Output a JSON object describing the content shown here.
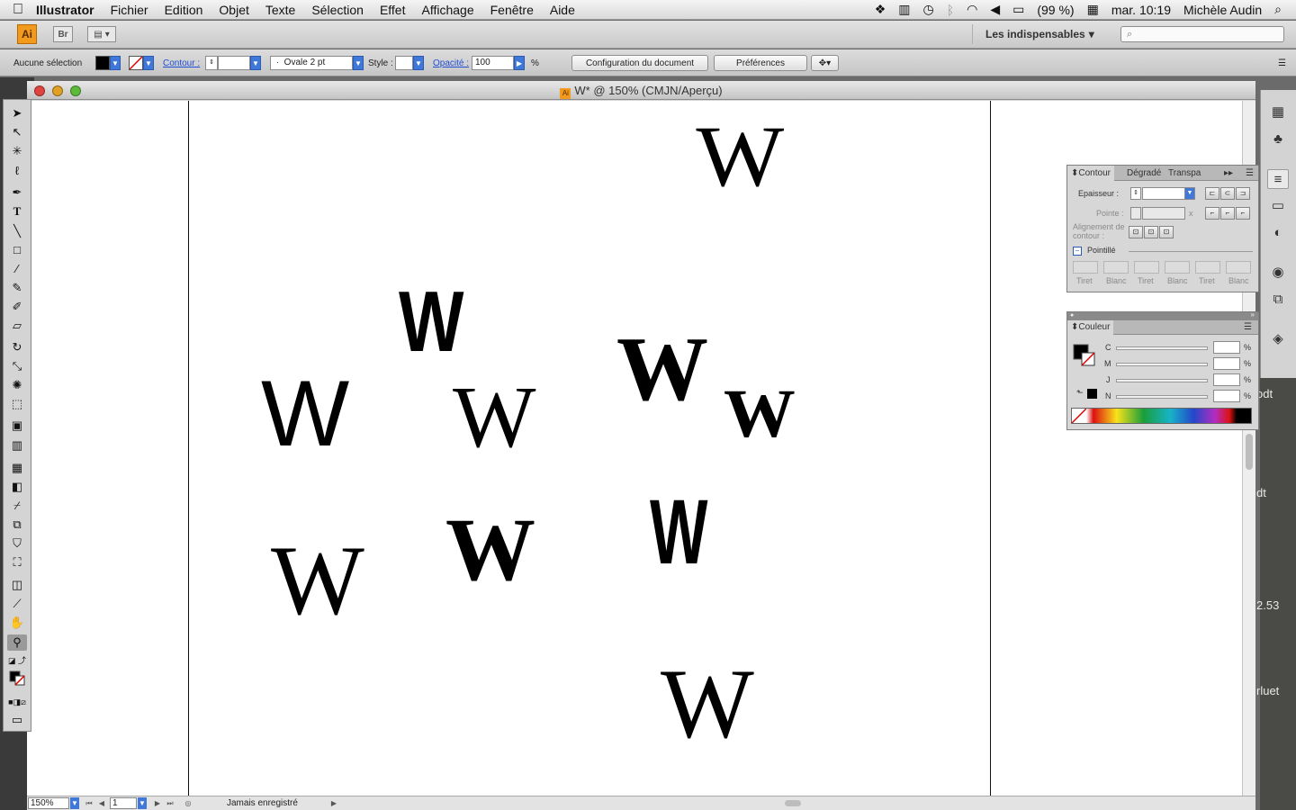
{
  "menubar": {
    "apple": "",
    "app_name": "Illustrator",
    "items": [
      "Fichier",
      "Edition",
      "Objet",
      "Texte",
      "Sélection",
      "Effet",
      "Affichage",
      "Fenêtre",
      "Aide"
    ],
    "battery": "(99 %)",
    "clock": "mar. 10:19",
    "user": "Michèle Audin"
  },
  "appbar": {
    "logo": "Ai",
    "bridge": "Br",
    "workspace": "Les indispensables",
    "workspace_arrow": "▾"
  },
  "controlbar": {
    "selection": "Aucune sélection",
    "contour_label": "Contour :",
    "brush": "Ovale 2 pt",
    "style_label": "Style :",
    "opacity_label": "Opacité :",
    "opacity_value": "100",
    "percent": "%",
    "doc_config": "Configuration du document",
    "preferences": "Préférences"
  },
  "document": {
    "title": "W* @ 150% (CMJN/Aperçu)",
    "zoom": "150%",
    "page": "1",
    "status": "Jamais enregistré"
  },
  "artboard": {
    "glyph": "W"
  },
  "contour_panel": {
    "tabs": [
      "Contour",
      "Dégradé",
      "Transpa"
    ],
    "epaisseur": "Epaisseur :",
    "pointe": "Pointe :",
    "x": "x",
    "alignement": "Alignement de contour :",
    "pointille": "Pointillé",
    "dash_labels": [
      "Tiret",
      "Blanc",
      "Tiret",
      "Blanc",
      "Tiret",
      "Blanc"
    ]
  },
  "color_panel": {
    "title": "Couleur",
    "channels": [
      "C",
      "M",
      "J",
      "N"
    ],
    "percent": "%"
  },
  "desktop_fragments": [
    "odt",
    "dt",
    "2.53",
    "rluet"
  ],
  "colors": {
    "accent_blue": "#3f78d8",
    "ai_orange": "#f29a1d"
  }
}
